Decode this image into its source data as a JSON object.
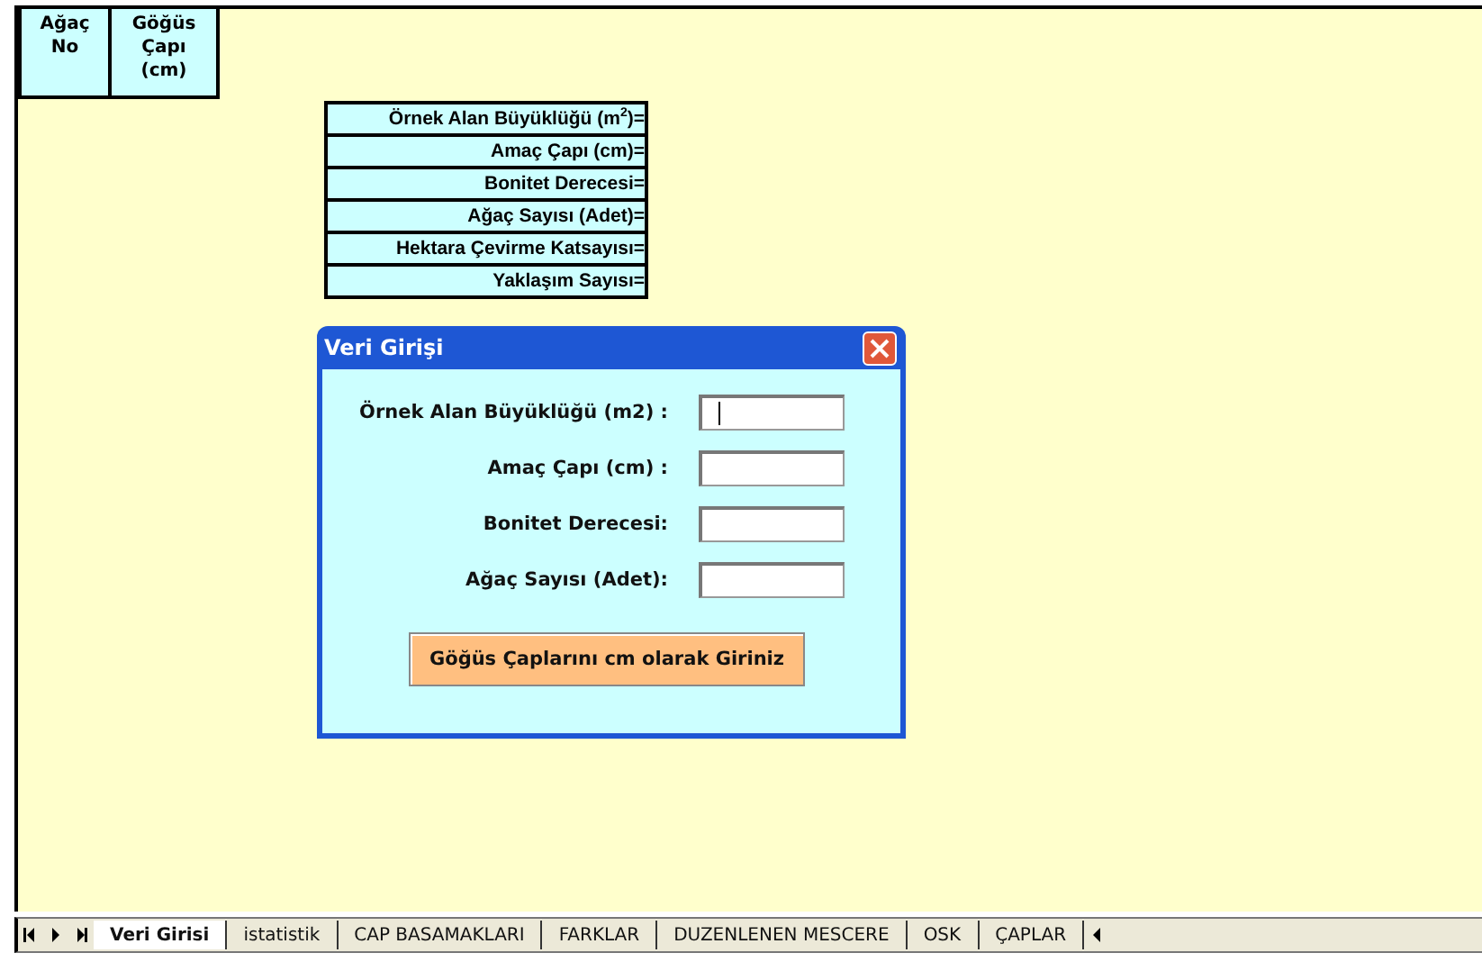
{
  "header_table": {
    "columns": [
      "Ağaç No",
      "Göğüs Çapı (cm)"
    ]
  },
  "parameters_table": {
    "rows": [
      "Örnek Alan Büyüklüğü (m$^{2}$)=",
      "Amaç Çapı (cm)=",
      "Bonitet Derecesi=",
      "Ağaç Sayısı (Adet)=",
      "Hektara Çevirme Katsayısı=",
      "Yaklaşım Sayısı="
    ]
  },
  "dialog": {
    "title": "Veri Girişi",
    "fields": [
      {
        "label": "Örnek Alan Büyüklüğü (m2) :",
        "focused": true
      },
      {
        "label": "Amaç Çapı (cm) :",
        "focused": false
      },
      {
        "label": "Bonitet Derecesi:",
        "focused": false
      },
      {
        "label": "Ağaç Sayısı (Adet):",
        "focused": false
      }
    ],
    "button": "Göğüs Çaplarını cm olarak Giriniz"
  },
  "sheet_tabs": [
    {
      "label": "Veri Girisi",
      "selected": true
    },
    {
      "label": "istatistik",
      "selected": false
    },
    {
      "label": "CAP BASAMAKLARI",
      "selected": false
    },
    {
      "label": "FARKLAR",
      "selected": false
    },
    {
      "label": "DUZENLENEN MESCERE",
      "selected": false
    },
    {
      "label": "OSK",
      "selected": false
    },
    {
      "label": "ÇAPLAR",
      "selected": false
    }
  ]
}
